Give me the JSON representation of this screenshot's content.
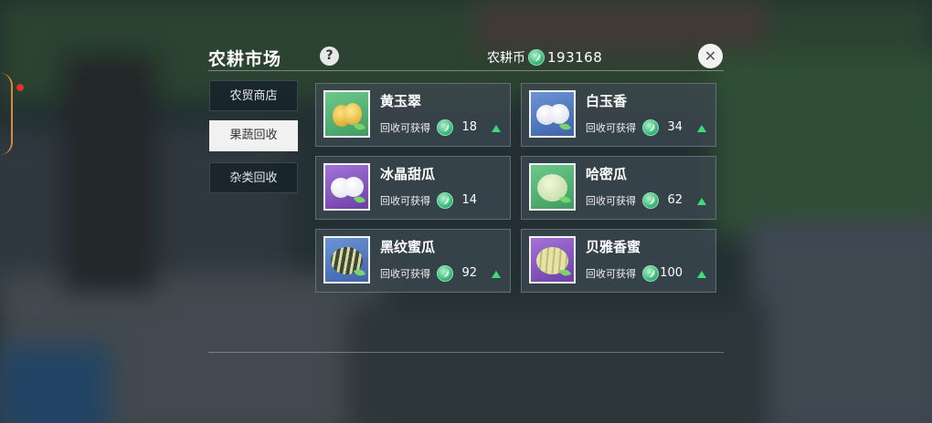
{
  "header": {
    "title": "农耕市场",
    "help_label": "?",
    "currency_label": "农耕币",
    "currency_amount": "193168",
    "close_label": "✕"
  },
  "tabs": [
    {
      "label": "农贸商店",
      "active": false
    },
    {
      "label": "果蔬回收",
      "active": true
    },
    {
      "label": "杂类回收",
      "active": false
    }
  ],
  "items": [
    {
      "name": "黄玉翠",
      "hint": "回收可获得",
      "qty": "18",
      "icon": "yellow-melon-icon"
    },
    {
      "name": "白玉香",
      "hint": "回收可获得",
      "qty": "34",
      "icon": "white-melon-icon"
    },
    {
      "name": "冰晶甜瓜",
      "hint": "回收可获得",
      "qty": "14",
      "icon": "ice-melon-icon"
    },
    {
      "name": "哈密瓜",
      "hint": "回收可获得",
      "qty": "62",
      "icon": "hami-melon-icon"
    },
    {
      "name": "黑纹蜜瓜",
      "hint": "回收可获得",
      "qty": "92",
      "icon": "striped-melon-icon"
    },
    {
      "name": "贝雅香蜜",
      "hint": "回收可获得",
      "qty": "100",
      "icon": "cream-melon-icon"
    }
  ],
  "colors": {
    "accent_green": "#3ddc7a",
    "coin_green": "#3dbd7c",
    "tab_active_bg": "#f1f1f1"
  }
}
